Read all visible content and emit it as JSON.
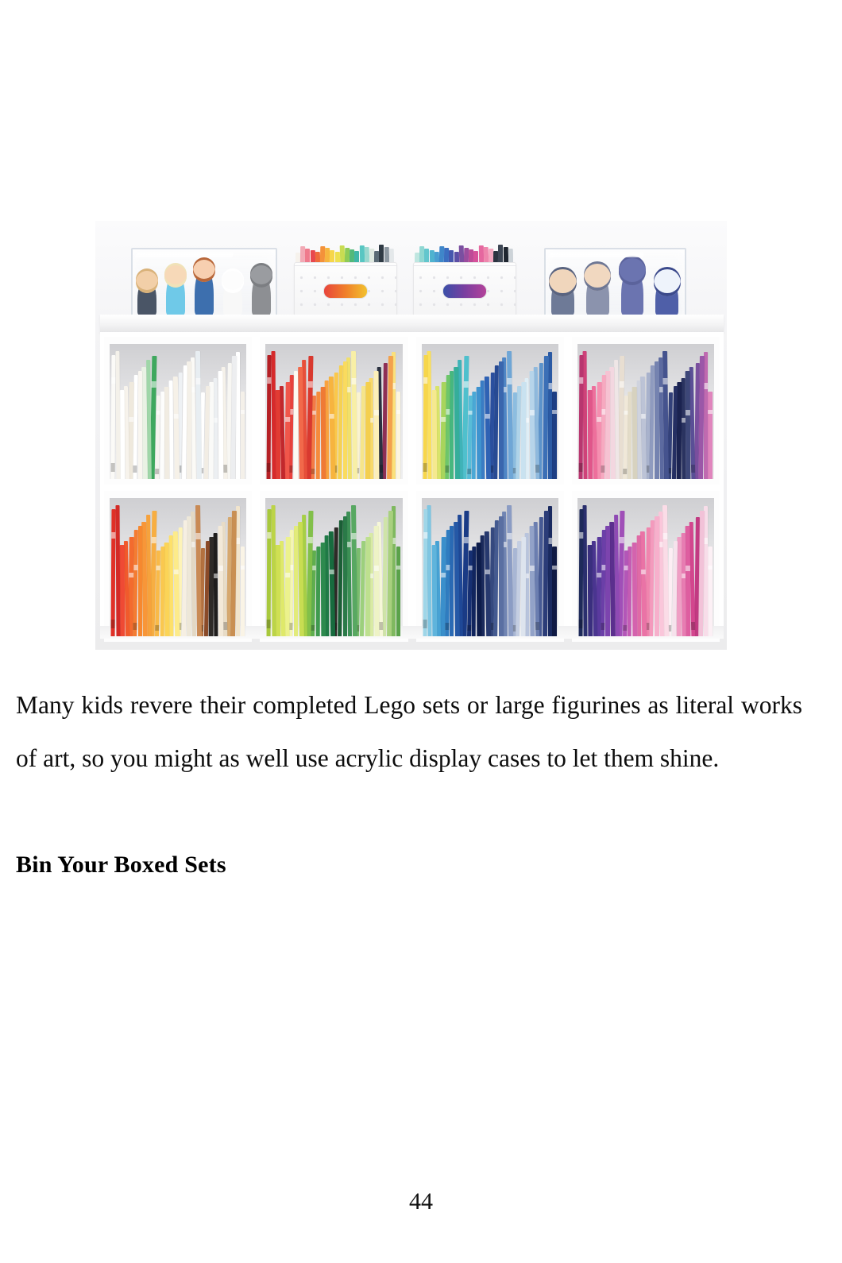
{
  "page": {
    "number": "44",
    "background_color": "#ffffff",
    "text_color": "#0d0d0d"
  },
  "figure": {
    "alt": "White four-cube bookshelf filled with children's books arranged by rainbow color order, topped with acrylic display cases holding Frozen figurines and white dotted storage bins",
    "caption": "",
    "frame_color": "#f2f2f2",
    "top_shelf": {
      "acrylic_cases": [
        {
          "name": "left-acrylic-display-case",
          "figurines": [
            {
              "label": "kristoff-figure",
              "body": "#4a5566",
              "head": "#f2cfa8",
              "hair": "#d9b27a"
            },
            {
              "label": "elsa-figure",
              "body": "#6fc9e8",
              "head": "#f7d9b8",
              "hair": "#f0e2b8"
            },
            {
              "label": "anna-figure",
              "body": "#3d6fae",
              "head": "#f7cfb0",
              "hair": "#b8673a"
            },
            {
              "label": "olaf-figure",
              "body": "#f8f8f8",
              "head": "#fdfdfd",
              "hair": "#ffffff"
            },
            {
              "label": "sven-figure",
              "body": "#8d8f93",
              "head": "#9a9ca0",
              "hair": "#7c7e82"
            }
          ]
        },
        {
          "name": "right-acrylic-display-case",
          "figurines": [
            {
              "label": "wizard-figure",
              "body": "#6e7a97",
              "head": "#f0d6bc",
              "hair": "#5a6480"
            },
            {
              "label": "small-figure",
              "body": "#8b93ad",
              "head": "#f1d8c0",
              "hair": "#6e7794"
            },
            {
              "label": "cat-figure",
              "body": "#6b74b0",
              "head": "#6b74b0",
              "hair": "#5b639c"
            },
            {
              "label": "bird-figure",
              "body": "#4f5fa8",
              "head": "#eef3fb",
              "hair": "#3c4a8c"
            }
          ]
        }
      ],
      "storage_bins": [
        {
          "name": "white-storage-bin-1",
          "handle_colors": [
            "#e8453c",
            "#f07f2a",
            "#f2c12e"
          ]
        },
        {
          "name": "white-storage-bin-2",
          "handle_colors": [
            "#3a4fa8",
            "#7a3fa0",
            "#b4429a"
          ]
        }
      ],
      "book_strips": [
        {
          "name": "rainbow-books-behind-bin-1",
          "colors": [
            "#f6f2ec",
            "#f2a9b5",
            "#ef7a8c",
            "#e8484f",
            "#ef6b3c",
            "#f4923a",
            "#f6b63f",
            "#f7d64a",
            "#eee04e",
            "#c9dc52",
            "#8ecb57",
            "#52b97a",
            "#3fb6a8",
            "#58c6c2",
            "#9ad8cf",
            "#dfe9e0",
            "#5a6a74",
            "#2f3a44",
            "#8e99a2",
            "#e4e8ea"
          ]
        },
        {
          "name": "rainbow-books-behind-bin-2",
          "colors": [
            "#bfe6e0",
            "#8fd7d2",
            "#63c6cd",
            "#4fb3cf",
            "#4a9ed1",
            "#3f86c9",
            "#3b6ec0",
            "#4657ae",
            "#5c4fa6",
            "#7a4fa0",
            "#9b4d9e",
            "#bd4b97",
            "#d6519a",
            "#e5679f",
            "#ee86ad",
            "#f3a7c0",
            "#2b3440",
            "#3d4654",
            "#1f2630",
            "#cdd3d8"
          ]
        }
      ]
    },
    "cubes": [
      {
        "name": "cube-mid-1",
        "theme": "white-and-cream-books",
        "books": [
          "#fbfaf7",
          "#f4f1ea",
          "#ffffff",
          "#f7f3ec",
          "#efe9dd",
          "#ffffff",
          "#f9f6f0",
          "#e9f2e4",
          "#9fd6a8",
          "#3fa85e",
          "#f6f4ef",
          "#fdfdfc",
          "#f1ece2",
          "#ffffff",
          "#f6f1e8",
          "#eef1f4",
          "#ffffff",
          "#f4f0e8",
          "#fbfaf6",
          "#e8eef2",
          "#ffffff",
          "#f2ede4",
          "#fafaf8",
          "#eceff2",
          "#ffffff",
          "#f6f2ea",
          "#f8f7f3",
          "#edeef0",
          "#ffffff",
          "#f4f0e9"
        ]
      },
      {
        "name": "cube-mid-2",
        "theme": "red-orange-yellow-books",
        "books": [
          "#b51f24",
          "#d62a2b",
          "#e23b33",
          "#c2282c",
          "#f0564a",
          "#e8423c",
          "#fdfaf2",
          "#f2694a",
          "#e84f3a",
          "#d9392f",
          "#f47a45",
          "#f58b3c",
          "#ef7a35",
          "#f9a23e",
          "#f7b43f",
          "#fbc84a",
          "#f6d152",
          "#fadb5e",
          "#f1e06a",
          "#f8efa6",
          "#faf3d0",
          "#f6e58a",
          "#f4cf4e",
          "#f8d96a",
          "#fcefb8",
          "#2b3140",
          "#8e2f55",
          "#f3a14c",
          "#fbe07a",
          "#fdf6de"
        ]
      },
      {
        "name": "cube-mid-3",
        "theme": "yellow-green-blue-books",
        "books": [
          "#f7d64a",
          "#fbe05c",
          "#f5e98f",
          "#d9e46a",
          "#a8d55c",
          "#6ec66a",
          "#47b77f",
          "#35ae9a",
          "#3fb3b8",
          "#4fc0cd",
          "#58bcd8",
          "#4aa8d6",
          "#3f93cf",
          "#3a7cc4",
          "#2f62b4",
          "#2a4f9e",
          "#274a93",
          "#3a66ae",
          "#4f86c6",
          "#6fa6d6",
          "#8cbde0",
          "#aed3e9",
          "#c9e2f0",
          "#dfeef6",
          "#b6d4ea",
          "#8fb9dd",
          "#5c93cb",
          "#3b6fb6",
          "#2b5aa4",
          "#1e3f84"
        ]
      },
      {
        "name": "cube-mid-4",
        "theme": "pink-purple-navy-books",
        "books": [
          "#b8366f",
          "#cf4279",
          "#e0568a",
          "#ee6f9c",
          "#f58fb0",
          "#f7a9c0",
          "#f6c2d2",
          "#f3d7e0",
          "#efe6e6",
          "#e8ded1",
          "#f0e8d8",
          "#e3dcc8",
          "#d7d2bf",
          "#cfd3de",
          "#bcc3d6",
          "#a8b2cc",
          "#8f9bbf",
          "#7583b0",
          "#5c6aa0",
          "#45538e",
          "#33417a",
          "#252f63",
          "#1b2350",
          "#2a3360",
          "#3d4778",
          "#5a4f96",
          "#7a4f9e",
          "#9b57a8",
          "#c06ab0",
          "#e085bd"
        ]
      },
      {
        "name": "cube-bot-1",
        "theme": "red-and-orange-books",
        "books": [
          "#e03027",
          "#d42a26",
          "#ef4a34",
          "#f15a2c",
          "#f36b2e",
          "#f47c32",
          "#f6882f",
          "#f89638",
          "#f6a23c",
          "#f7ae42",
          "#f9ba48",
          "#fac84f",
          "#fbd457",
          "#fde06a",
          "#fdeb8a",
          "#fdf3b8",
          "#f6efe2",
          "#ede7d8",
          "#e3d8c4",
          "#c98a55",
          "#b4713f",
          "#8a4a28",
          "#2e2a27",
          "#1f1d1c",
          "#f3e9d8",
          "#e8dcc6",
          "#d6a86e",
          "#c98f52",
          "#f1e4cc",
          "#faf4e6"
        ]
      },
      {
        "name": "cube-bot-2",
        "theme": "green-and-yellow-books",
        "books": [
          "#a8c83c",
          "#bcd447",
          "#cfe053",
          "#dfe96a",
          "#ecf28c",
          "#f5f6b4",
          "#e2eb7a",
          "#c8dd52",
          "#a6cf46",
          "#82c04a",
          "#5fae4e",
          "#3f9a4f",
          "#2d8a4e",
          "#1f7a46",
          "#176b3e",
          "#2e2a27",
          "#1b5e36",
          "#2a7a48",
          "#3c9055",
          "#58a862",
          "#7bbd6e",
          "#9cd07c",
          "#bde08e",
          "#d8eaa4",
          "#eef3c6",
          "#f6f7d8",
          "#cfe4a8",
          "#a8d07e",
          "#7fb95f",
          "#5aa24a"
        ]
      },
      {
        "name": "cube-bot-3",
        "theme": "blue-and-navy-books",
        "books": [
          "#9fd6e8",
          "#7fc6e2",
          "#5fb4dc",
          "#47a2d4",
          "#3a8fcb",
          "#2f7cc0",
          "#2a6ab4",
          "#2558a6",
          "#1f4897",
          "#1a3b86",
          "#162f72",
          "#11255e",
          "#0d1c4a",
          "#1a2a5c",
          "#27396e",
          "#35497f",
          "#445a90",
          "#5a6fa2",
          "#7185b3",
          "#8b9cc4",
          "#a8b6d4",
          "#c4cee2",
          "#dde4ee",
          "#b8c4dd",
          "#92a2c8",
          "#6b7eb0",
          "#475a94",
          "#2b3c78",
          "#1a2a60",
          "#101a44"
        ]
      },
      {
        "name": "cube-bot-4",
        "theme": "purple-and-pink-books",
        "books": [
          "#1e2a5a",
          "#2a2f6e",
          "#3a2f7e",
          "#4a3590",
          "#5a3a9e",
          "#6b3fa8",
          "#7c44ae",
          "#5b2f8e",
          "#8f4ab4",
          "#a04fb8",
          "#b356b8",
          "#c45cb4",
          "#d463ae",
          "#e06aa6",
          "#ea73a6",
          "#f085ae",
          "#f49abd",
          "#f7b0cc",
          "#fac6da",
          "#fbdce7",
          "#fdeef4",
          "#f6e2ec",
          "#ef9ec4",
          "#e87cb2",
          "#de5ea0",
          "#d3468e",
          "#c23a82",
          "#f2c2d8",
          "#f8dde9",
          "#fcf0f5"
        ]
      }
    ]
  },
  "content": {
    "paragraph": "Many kids revere their completed Lego sets or large figurines as literal works of art, so you might as well use acrylic display cases to let them shine.",
    "subheading": "Bin Your Boxed Sets"
  }
}
